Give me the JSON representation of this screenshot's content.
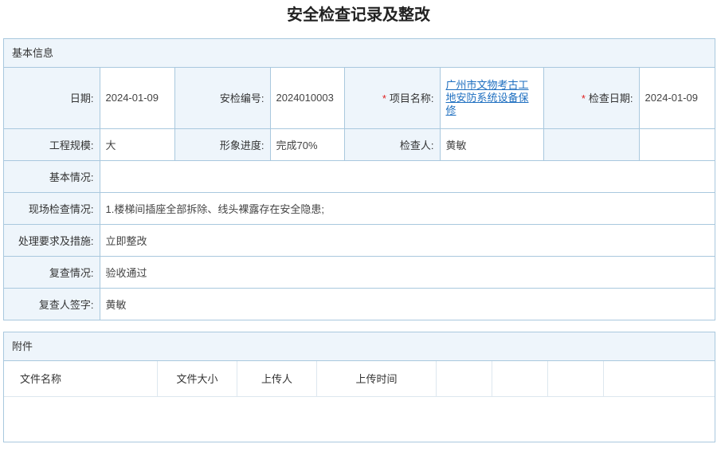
{
  "page": {
    "title": "安全检查记录及整改"
  },
  "basic_info": {
    "section_title": "基本信息",
    "rows": {
      "date_label": "日期:",
      "date_value": "2024-01-09",
      "code_label": "安检编号:",
      "code_value": "2024010003",
      "project_label": "项目名称:",
      "project_value": "广州市文物考古工地安防系统设备保修",
      "check_date_label": "检查日期:",
      "check_date_value": "2024-01-09",
      "scale_label": "工程规模:",
      "scale_value": "大",
      "progress_label": "形象进度:",
      "progress_value": "完成70%",
      "inspector_label": "检查人:",
      "inspector_value": "黄敏",
      "basic_situation_label": "基本情况:",
      "basic_situation_value": "",
      "site_check_label": "现场检查情况:",
      "site_check_value": "1.楼梯间插座全部拆除、线头裸露存在安全隐患;",
      "handling_label": "处理要求及措施:",
      "handling_value": "立即整改",
      "recheck_label": "复查情况:",
      "recheck_value": "验收通过",
      "recheck_sign_label": "复查人签字:",
      "recheck_sign_value": "黄敏"
    },
    "required_mark": "*"
  },
  "attachments": {
    "section_title": "附件",
    "columns": {
      "name": "文件名称",
      "size": "文件大小",
      "uploader": "上传人",
      "upload_time": "上传时间"
    },
    "rows": []
  }
}
